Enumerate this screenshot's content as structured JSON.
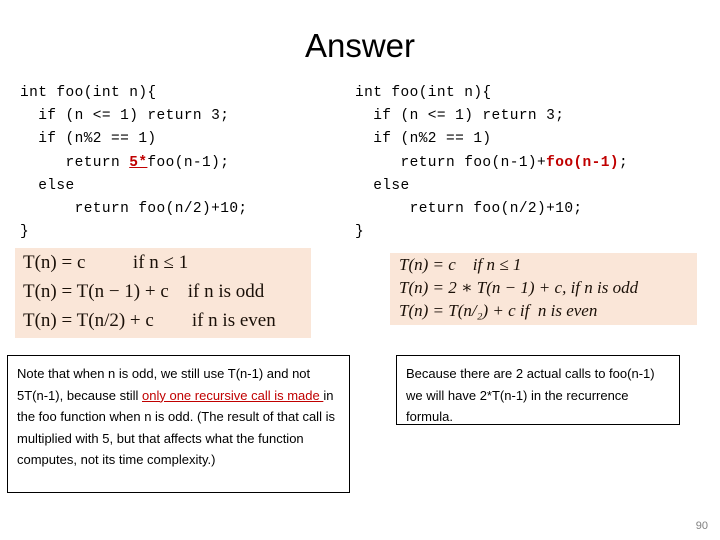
{
  "slide": {
    "title": "Answer",
    "page_number": "90"
  },
  "colors": {
    "highlight_red": "#C00000",
    "formula_box_bg": "#FAE6D8",
    "page_number_gray": "#808080",
    "text_black": "#000000"
  },
  "code_left": {
    "name": "original-function-code",
    "lines": [
      {
        "pre": "int foo(int n){",
        "hl": "",
        "hl_style": "none",
        "post": ""
      },
      {
        "pre": "  if (n <= 1) return 3;",
        "hl": "",
        "hl_style": "none",
        "post": ""
      },
      {
        "pre": "  if (n%2 == 1)",
        "hl": "",
        "hl_style": "none",
        "post": ""
      },
      {
        "pre": "     return ",
        "hl": "5*",
        "hl_style": "red-underline",
        "post": "foo(n-1);"
      },
      {
        "pre": "  else",
        "hl": "",
        "hl_style": "none",
        "post": ""
      },
      {
        "pre": "      return foo(n/2)+10;",
        "hl": "",
        "hl_style": "none",
        "post": ""
      },
      {
        "pre": "}",
        "hl": "",
        "hl_style": "none",
        "post": ""
      }
    ]
  },
  "code_right": {
    "name": "modified-function-code",
    "lines": [
      {
        "pre": "int foo(int n){",
        "hl": "",
        "hl_style": "none",
        "post": ""
      },
      {
        "pre": "  if (n <= 1) return 3;",
        "hl": "",
        "hl_style": "none",
        "post": ""
      },
      {
        "pre": "  if (n%2 == 1)",
        "hl": "",
        "hl_style": "none",
        "post": ""
      },
      {
        "pre": "     return foo(n-1)+",
        "hl": "foo(n-1)",
        "hl_style": "red",
        "post": ";"
      },
      {
        "pre": "  else",
        "hl": "",
        "hl_style": "none",
        "post": ""
      },
      {
        "pre": "      return foo(n/2)+10;",
        "hl": "",
        "hl_style": "none",
        "post": ""
      },
      {
        "pre": "}",
        "hl": "",
        "hl_style": "none",
        "post": ""
      }
    ]
  },
  "formula_left": {
    "name": "recurrence-left",
    "lines": [
      "T(n) = c          if n ≤ 1",
      "T(n) = T(n − 1) + c    if n is odd",
      "T(n) = T(n/2) + c        if n is even"
    ]
  },
  "formula_right": {
    "name": "recurrence-right",
    "lines": [
      "T(n) = c    if n ≤ 1",
      "T(n) = 2 ∗ T(n − 1) + c, if n is odd",
      "T(n) = T(n/₂) + c if  n is even"
    ]
  },
  "note_left": {
    "name": "explanation-left",
    "part1": "Note that when n is odd, we still use T(n-1) and not 5T(n-1), because still ",
    "highlight": "only one recursive call is made ",
    "part2": "in the foo function when n is odd. (The result of that call is multiplied with 5, but that affects what the function computes, not its time complexity.)"
  },
  "note_right": {
    "name": "explanation-right",
    "text": "Because there are 2 actual calls to foo(n-1) we will have 2*T(n-1) in the recurrence formula."
  }
}
